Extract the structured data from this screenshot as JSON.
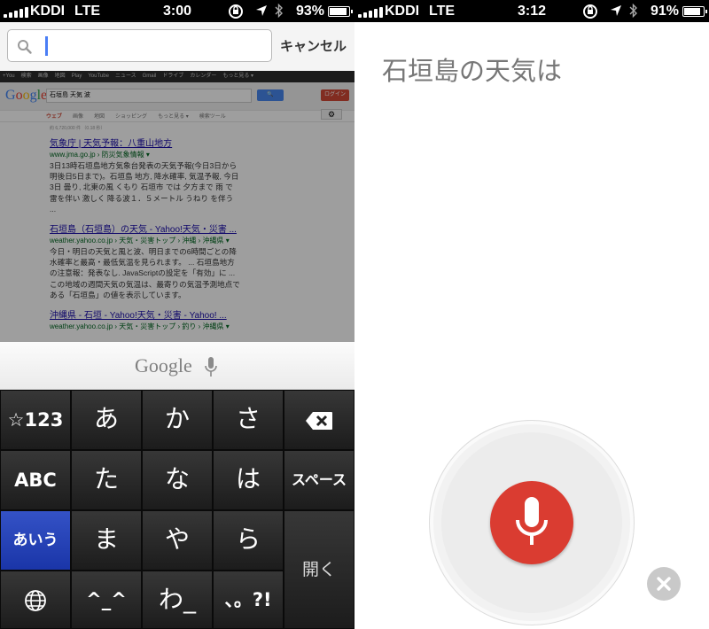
{
  "left": {
    "status": {
      "carrier": "KDDI",
      "network": "LTE",
      "time": "3:00",
      "battery": "93%",
      "battery_level": 0.93
    },
    "search": {
      "value": "",
      "cancel_label": "キャンセル"
    },
    "webpage": {
      "gbar": [
        "+You",
        "検索",
        "画像",
        "地図",
        "Play",
        "YouTube",
        "ニュース",
        "Gmail",
        "ドライブ",
        "カレンダー",
        "もっと見る ▾"
      ],
      "logo": "Google",
      "query": "石垣島 天気 波",
      "search_btn": "🔍",
      "login_btn": "ログイン",
      "tabs": [
        "ウェブ",
        "画像",
        "地図",
        "ショッピング",
        "もっと見る ▾",
        "検索ツール"
      ],
      "count": "約 6,720,000 件 （0.18 秒）",
      "results": [
        {
          "title": "気象庁 | 天気予報：八重山地方",
          "url": "www.jma.go.jp › 防災気象情報 ▾",
          "snippet": "3日13時石垣島地方気象台発表の天気予報(今日3日から明後日5日まで)。石垣島 地方, 降水確率, 気温予報, 今日3日 曇り, 北東の風 くもり 石垣市 では 夕方まで 雨 で 雷を伴い 激しく 降る波１．５メートル うねり を伴う ..."
        },
        {
          "title": "石垣島（石垣島）の天気 - Yahoo!天気・災害 ...",
          "url": "weather.yahoo.co.jp › 天気・災害トップ › 沖縄 › 沖縄県 ▾",
          "snippet": "今日・明日の天気と風と波、明日までの6時間ごとの降水確率と最高・最低気温を見られます。 ... 石垣島地方の注意報：発表なし. JavaScriptの設定を「有効」に ... この地域の週間天気の気温は、最寄りの気温予測地点である「石垣島」の値を表示しています。"
        },
        {
          "title": "沖縄県 - 石垣 - Yahoo!天気・災害 - Yahoo! ...",
          "url": "weather.yahoo.co.jp › 天気・災害トップ › 釣り › 沖縄県 ▾",
          "snippet": ""
        }
      ]
    },
    "voice_bar": {
      "label": "Google"
    },
    "keyboard": {
      "row1": [
        "☆123",
        "あ",
        "か",
        "さ"
      ],
      "row2": [
        "ABC",
        "た",
        "な",
        "は",
        "スペース"
      ],
      "row3": [
        "あいう",
        "ま",
        "や",
        "ら"
      ],
      "row4": [
        "🌐",
        "^_^",
        "わ_",
        "、。?!"
      ],
      "open_key": "開く"
    }
  },
  "right": {
    "status": {
      "carrier": "KDDI",
      "network": "LTE",
      "time": "3:12",
      "battery": "91%",
      "battery_level": 0.91
    },
    "query": "石垣島の天気は"
  }
}
